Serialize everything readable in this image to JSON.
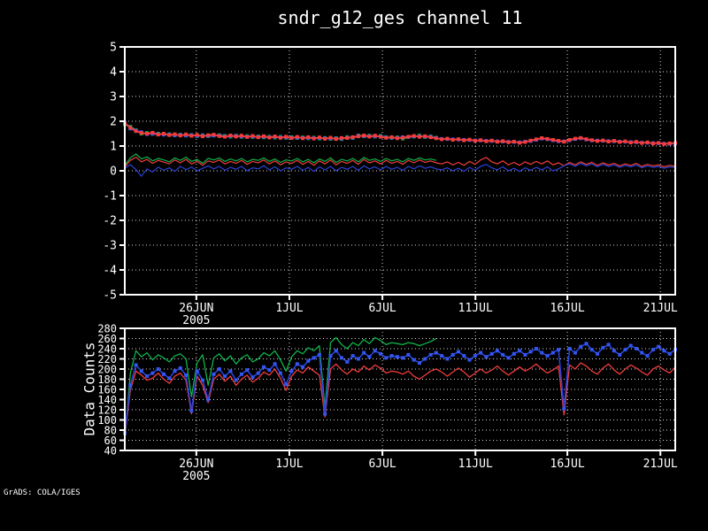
{
  "title": "sndr_g12_ges channel 11",
  "watermark": "GrADS: COLA/IGES",
  "bottom_ylabel": "Data Counts",
  "colors": {
    "background": "#000000",
    "axis": "#ffffff",
    "red": "#f23c3c",
    "green": "#0cb44a",
    "blue_line": "#2a42d8",
    "blue_marker": "#3355f0"
  },
  "chart_data": [
    {
      "id": "top",
      "type": "line",
      "title": "sndr_g12_ges channel 11",
      "xlabel": "",
      "ylabel": "",
      "ylim": [
        -5,
        5
      ],
      "n": 100,
      "grid": "dotted",
      "legend": "none",
      "y_ticks": [
        5,
        4,
        3,
        2,
        1,
        0,
        -1,
        -2,
        -3,
        -4,
        -5
      ],
      "x_ticks": [
        {
          "frac": 0.13,
          "label": "26JUN",
          "sublabel": "2005"
        },
        {
          "frac": 0.299,
          "label": "1JUL"
        },
        {
          "frac": 0.468,
          "label": "6JUL"
        },
        {
          "frac": 0.637,
          "label": "11JUL"
        },
        {
          "frac": 0.804,
          "label": "16JUL"
        },
        {
          "frac": 0.973,
          "label": "21JUL"
        }
      ],
      "series": [
        {
          "name": "green-marker-series",
          "color": "#0cb44a",
          "marker": true,
          "marker_color": "#0cb44a",
          "width": 1.8,
          "values": [
            1.88,
            1.78,
            1.64,
            1.5,
            1.53,
            1.49,
            1.5,
            1.46,
            1.48,
            1.43,
            1.46,
            1.42,
            1.45,
            1.4,
            1.44,
            1.4,
            1.42,
            1.44,
            1.41,
            1.38,
            1.42,
            1.37,
            1.4,
            1.36,
            1.39,
            1.35,
            1.38,
            1.34,
            1.37,
            1.33,
            1.36,
            1.32,
            1.35,
            1.31,
            1.34,
            1.3,
            1.33,
            1.29,
            1.32,
            1.28,
            1.36,
            1.32,
            1.43,
            1.39,
            1.42,
            1.38,
            1.41,
            1.36,
            1.32,
            1.35,
            1.3,
            1.36,
            1.38,
            1.42,
            1.36,
            1.39,
            1.34
          ]
        },
        {
          "name": "blue-marker-series",
          "color": "#2a42d8",
          "marker": true,
          "marker_color": "#3355f0",
          "width": 1.8,
          "values": [
            1.95,
            1.7,
            1.63,
            1.56,
            1.48,
            1.5,
            1.48,
            1.46,
            1.46,
            1.44,
            1.45,
            1.43,
            1.44,
            1.41,
            1.42,
            1.41,
            1.43,
            1.42,
            1.39,
            1.4,
            1.41,
            1.39,
            1.38,
            1.38,
            1.37,
            1.37,
            1.36,
            1.36,
            1.35,
            1.35,
            1.34,
            1.34,
            1.33,
            1.33,
            1.32,
            1.32,
            1.31,
            1.31,
            1.3,
            1.3,
            1.34,
            1.34,
            1.41,
            1.4,
            1.4,
            1.39,
            1.39,
            1.35,
            1.34,
            1.33,
            1.36,
            1.36,
            1.39,
            1.39,
            1.38,
            1.37,
            1.33,
            1.29,
            1.28,
            1.27,
            1.26,
            1.25,
            1.24,
            1.23,
            1.22,
            1.21,
            1.2,
            1.19,
            1.18,
            1.17,
            1.16,
            1.15,
            1.18,
            1.2,
            1.25,
            1.3,
            1.27,
            1.23,
            1.19,
            1.19,
            1.23,
            1.28,
            1.31,
            1.26,
            1.22,
            1.22,
            1.21,
            1.2,
            1.19,
            1.18,
            1.17,
            1.16,
            1.15,
            1.14,
            1.13,
            1.12,
            1.11,
            1.1,
            1.09,
            1.1
          ]
        },
        {
          "name": "red-marker-series",
          "color": "#f23c3c",
          "marker": true,
          "marker_color": "#f23c3c",
          "width": 1.8,
          "values": [
            1.92,
            1.74,
            1.6,
            1.53,
            1.5,
            1.54,
            1.46,
            1.5,
            1.44,
            1.48,
            1.42,
            1.47,
            1.41,
            1.45,
            1.39,
            1.44,
            1.46,
            1.4,
            1.37,
            1.43,
            1.38,
            1.42,
            1.36,
            1.41,
            1.35,
            1.4,
            1.34,
            1.39,
            1.33,
            1.38,
            1.32,
            1.37,
            1.31,
            1.36,
            1.3,
            1.35,
            1.29,
            1.34,
            1.28,
            1.33,
            1.32,
            1.36,
            1.39,
            1.43,
            1.38,
            1.42,
            1.37,
            1.33,
            1.36,
            1.31,
            1.34,
            1.38,
            1.41,
            1.37,
            1.4,
            1.35,
            1.31,
            1.27,
            1.3,
            1.25,
            1.28,
            1.23,
            1.26,
            1.21,
            1.24,
            1.19,
            1.22,
            1.17,
            1.2,
            1.15,
            1.18,
            1.13,
            1.16,
            1.22,
            1.27,
            1.32,
            1.29,
            1.25,
            1.21,
            1.17,
            1.25,
            1.3,
            1.33,
            1.28,
            1.24,
            1.2,
            1.23,
            1.18,
            1.21,
            1.16,
            1.19,
            1.14,
            1.17,
            1.12,
            1.15,
            1.1,
            1.13,
            1.08,
            1.11,
            1.12
          ]
        },
        {
          "name": "green-line-series",
          "color": "#0cb44a",
          "marker": false,
          "width": 1.2,
          "values": [
            0.22,
            0.52,
            0.68,
            0.48,
            0.56,
            0.4,
            0.5,
            0.44,
            0.36,
            0.52,
            0.42,
            0.55,
            0.38,
            0.46,
            0.3,
            0.5,
            0.44,
            0.52,
            0.38,
            0.48,
            0.4,
            0.5,
            0.36,
            0.46,
            0.42,
            0.52,
            0.38,
            0.48,
            0.34,
            0.44,
            0.4,
            0.5,
            0.36,
            0.46,
            0.32,
            0.48,
            0.38,
            0.52,
            0.34,
            0.46,
            0.4,
            0.5,
            0.36,
            0.54,
            0.42,
            0.48,
            0.38,
            0.5,
            0.4,
            0.46,
            0.36,
            0.5,
            0.42,
            0.52,
            0.44,
            0.48,
            0.42
          ]
        },
        {
          "name": "red-line-series",
          "color": "#f23c3c",
          "marker": false,
          "width": 1.2,
          "values": [
            0.16,
            0.42,
            0.55,
            0.36,
            0.46,
            0.3,
            0.42,
            0.35,
            0.28,
            0.44,
            0.32,
            0.46,
            0.28,
            0.38,
            0.22,
            0.4,
            0.34,
            0.44,
            0.28,
            0.38,
            0.3,
            0.42,
            0.26,
            0.38,
            0.32,
            0.44,
            0.28,
            0.4,
            0.24,
            0.36,
            0.3,
            0.42,
            0.26,
            0.38,
            0.22,
            0.4,
            0.28,
            0.44,
            0.24,
            0.38,
            0.3,
            0.42,
            0.26,
            0.46,
            0.32,
            0.4,
            0.28,
            0.42,
            0.3,
            0.38,
            0.26,
            0.42,
            0.32,
            0.44,
            0.34,
            0.4,
            0.32,
            0.28,
            0.36,
            0.24,
            0.34,
            0.22,
            0.38,
            0.26,
            0.44,
            0.54,
            0.36,
            0.28,
            0.4,
            0.24,
            0.34,
            0.22,
            0.36,
            0.26,
            0.38,
            0.28,
            0.4,
            0.24,
            0.32,
            0.2,
            0.34,
            0.24,
            0.36,
            0.26,
            0.34,
            0.22,
            0.32,
            0.24,
            0.3,
            0.2,
            0.28,
            0.22,
            0.3,
            0.18,
            0.26,
            0.2,
            0.24,
            0.16,
            0.22,
            0.18
          ]
        },
        {
          "name": "blue-line-series",
          "color": "#2a42d8",
          "marker": false,
          "width": 1.2,
          "values": [
            0.1,
            0.25,
            0.05,
            -0.22,
            0.08,
            -0.05,
            0.15,
            0.02,
            0.12,
            -0.02,
            0.18,
            0.05,
            0.15,
            0.0,
            0.1,
            0.2,
            0.08,
            0.18,
            0.02,
            0.14,
            0.06,
            0.18,
            0.0,
            0.12,
            0.08,
            0.2,
            0.04,
            0.16,
            0.0,
            0.12,
            0.06,
            0.18,
            0.02,
            0.14,
            -0.02,
            0.16,
            0.04,
            0.18,
            0.0,
            0.14,
            0.06,
            0.18,
            0.02,
            0.2,
            0.08,
            0.16,
            0.04,
            0.18,
            0.06,
            0.14,
            0.02,
            0.18,
            0.08,
            0.2,
            0.1,
            0.16,
            0.08,
            0.04,
            0.12,
            0.0,
            0.1,
            -0.02,
            0.14,
            0.02,
            0.18,
            0.26,
            0.12,
            0.04,
            0.16,
            0.0,
            0.1,
            -0.02,
            0.12,
            0.02,
            0.14,
            0.04,
            0.16,
            0.0,
            0.08,
            0.2,
            0.28,
            0.18,
            0.3,
            0.2,
            0.28,
            0.16,
            0.26,
            0.18,
            0.24,
            0.14,
            0.22,
            0.16,
            0.24,
            0.12,
            0.2,
            0.14,
            0.18,
            0.1,
            0.16,
            0.14
          ]
        }
      ]
    },
    {
      "id": "bottom",
      "type": "line",
      "title": "",
      "xlabel": "",
      "ylabel": "Data Counts",
      "ylim": [
        40,
        280
      ],
      "n": 100,
      "grid": "dotted",
      "legend": "none",
      "y_ticks": [
        280,
        260,
        240,
        220,
        200,
        180,
        160,
        140,
        120,
        100,
        80,
        60,
        40
      ],
      "x_ticks": [
        {
          "frac": 0.13,
          "label": "26JUN",
          "sublabel": "2005"
        },
        {
          "frac": 0.299,
          "label": "1JUL"
        },
        {
          "frac": 0.468,
          "label": "6JUL"
        },
        {
          "frac": 0.637,
          "label": "11JUL"
        },
        {
          "frac": 0.804,
          "label": "16JUL"
        },
        {
          "frac": 0.973,
          "label": "21JUL"
        }
      ],
      "series": [
        {
          "name": "green-counts",
          "color": "#0cb44a",
          "marker": false,
          "width": 1.3,
          "values": [
            58,
            192,
            236,
            224,
            232,
            218,
            228,
            222,
            214,
            226,
            230,
            220,
            146,
            212,
            228,
            168,
            222,
            230,
            216,
            226,
            210,
            222,
            228,
            214,
            220,
            232,
            226,
            236,
            218,
            196,
            224,
            236,
            230,
            242,
            236,
            246,
            124,
            252,
            262,
            248,
            240,
            252,
            246,
            258,
            250,
            262,
            256,
            248,
            252,
            250,
            248,
            252,
            250,
            246,
            250,
            254,
            260
          ]
        },
        {
          "name": "red-counts",
          "color": "#f23c3c",
          "marker": false,
          "width": 1.3,
          "values": [
            68,
            158,
            196,
            188,
            178,
            182,
            192,
            180,
            172,
            186,
            192,
            178,
            112,
            186,
            168,
            134,
            180,
            190,
            176,
            186,
            168,
            180,
            188,
            174,
            182,
            194,
            188,
            200,
            182,
            158,
            186,
            198,
            192,
            204,
            196,
            188,
            106,
            200,
            210,
            198,
            190,
            200,
            194,
            206,
            198,
            208,
            202,
            192,
            196,
            194,
            190,
            196,
            186,
            180,
            188,
            196,
            200,
            194,
            186,
            194,
            202,
            194,
            184,
            192,
            200,
            192,
            198,
            206,
            196,
            188,
            196,
            204,
            196,
            202,
            210,
            200,
            192,
            198,
            206,
            110,
            208,
            200,
            212,
            206,
            196,
            190,
            202,
            210,
            198,
            190,
            200,
            208,
            202,
            194,
            188,
            200,
            206,
            198,
            192,
            204
          ]
        },
        {
          "name": "blue-counts",
          "color": "#2a42d8",
          "marker": true,
          "marker_color": "#3355f0",
          "width": 1.6,
          "values": [
            74,
            168,
            208,
            196,
            186,
            192,
            200,
            190,
            182,
            196,
            202,
            188,
            118,
            196,
            178,
            140,
            190,
            200,
            186,
            196,
            178,
            190,
            198,
            184,
            192,
            204,
            198,
            210,
            192,
            170,
            196,
            210,
            204,
            216,
            222,
            228,
            112,
            226,
            236,
            222,
            214,
            226,
            220,
            232,
            224,
            236,
            230,
            222,
            226,
            224,
            222,
            228,
            218,
            212,
            220,
            228,
            232,
            226,
            220,
            228,
            234,
            226,
            218,
            226,
            232,
            224,
            230,
            236,
            228,
            222,
            230,
            236,
            228,
            234,
            240,
            232,
            226,
            232,
            238,
            122,
            240,
            232,
            244,
            250,
            238,
            230,
            242,
            248,
            236,
            228,
            238,
            246,
            240,
            232,
            226,
            238,
            244,
            236,
            230,
            238
          ]
        }
      ]
    }
  ]
}
